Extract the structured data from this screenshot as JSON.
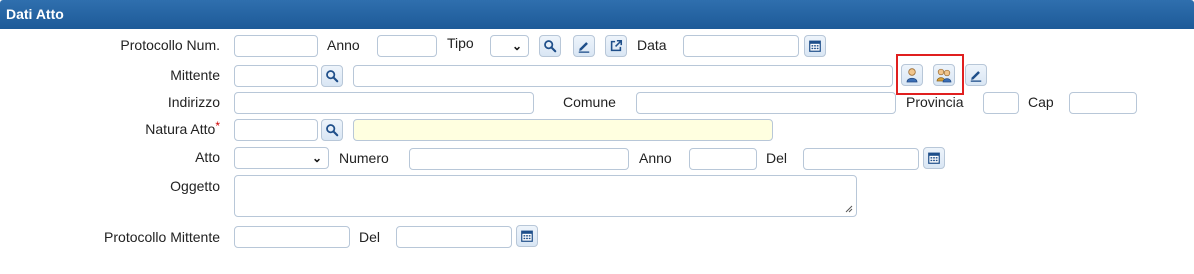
{
  "header": {
    "title": "Dati Atto"
  },
  "row1": {
    "protocollo_label": "Protocollo Num.",
    "protocollo_value": "",
    "anno_label": "Anno",
    "anno_value": "",
    "tipo_label": "Tipo",
    "tipo_value": "",
    "data_label": "Data",
    "data_value": ""
  },
  "row2": {
    "mittente_label": "Mittente",
    "code_value": "",
    "name_value": ""
  },
  "row3": {
    "indirizzo_label": "Indirizzo",
    "indirizzo_value": "",
    "comune_label": "Comune",
    "comune_value": "",
    "provincia_label": "Provincia",
    "provincia_value": "",
    "cap_label": "Cap",
    "cap_value": ""
  },
  "row4": {
    "natura_label": "Natura Atto",
    "required_mark": "*",
    "code_value": "",
    "desc_value": ""
  },
  "row5": {
    "atto_label": "Atto",
    "atto_value": "",
    "numero_label": "Numero",
    "numero_value": "",
    "anno_label": "Anno",
    "anno_value": "",
    "del_label": "Del",
    "del_value": ""
  },
  "row6": {
    "oggetto_label": "Oggetto",
    "oggetto_value": ""
  },
  "row7": {
    "protocollo_mittente_label": "Protocollo Mittente",
    "protocollo_mittente_value": "",
    "del_label": "Del",
    "del_value": ""
  },
  "icons": {
    "search": "search-icon",
    "edit": "pencil-icon",
    "open": "external-link-icon",
    "calendar": "calendar-icon",
    "person": "person-icon",
    "people": "people-icon"
  },
  "colors": {
    "header": "#1d5a98",
    "highlight": "#e01f1f",
    "required": "#d00000",
    "yellow_field": "#ffffe0"
  }
}
